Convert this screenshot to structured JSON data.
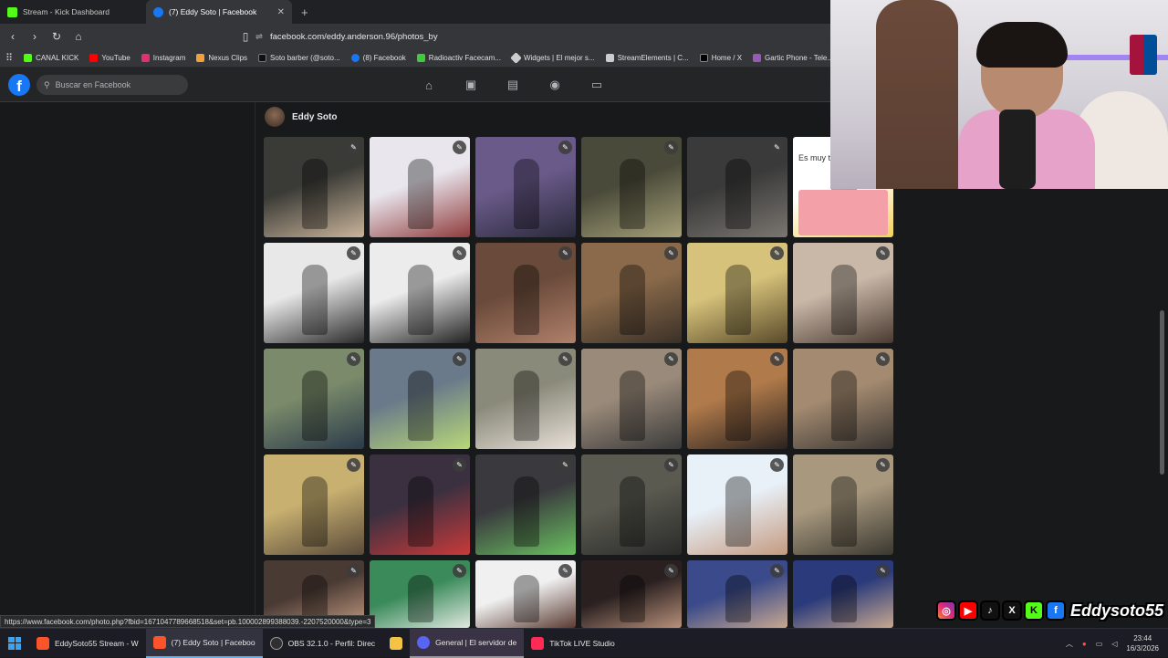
{
  "browser": {
    "tabs": [
      {
        "title": "Stream - Kick Dashboard",
        "color": "#53fc18",
        "active": false
      },
      {
        "title": "(7) Eddy Soto | Facebook",
        "color": "#1877f2",
        "active": true
      }
    ],
    "url": "facebook.com/eddy.anderson.96/photos_by",
    "bookmarks": [
      {
        "label": "CANAL KICK",
        "color": "#53fc18"
      },
      {
        "label": "YouTube",
        "color": "#ff0000"
      },
      {
        "label": "Instagram",
        "color": "#e1306c"
      },
      {
        "label": "Nexus Clips",
        "color": "#f2a13a"
      },
      {
        "label": "Soto barber (@soto...",
        "color": "#111111"
      },
      {
        "label": "(8) Facebook",
        "color": "#1877f2"
      },
      {
        "label": "Radioactiv Facecam...",
        "color": "#3ccc3c"
      },
      {
        "label": "Widgets | El mejor s...",
        "color": "#cccccc"
      },
      {
        "label": "StreamElements | C...",
        "color": "#cccccc"
      },
      {
        "label": "Home / X",
        "color": "#000000"
      },
      {
        "label": "Gartic Phone - Tele...",
        "color": "#9b59b6"
      }
    ]
  },
  "facebook": {
    "search_placeholder": "Buscar en Facebook",
    "nav_icons": [
      "home-icon",
      "video-icon",
      "marketplace-icon",
      "groups-icon",
      "gaming-icon"
    ],
    "profile_name": "Eddy Soto",
    "partial_text": "Es muy ti",
    "photo_rows": 5,
    "photo_cols": 6
  },
  "status_url": "https://www.facebook.com/photo.php?fbid=1671047789668518&set=pb.100002899388039.-2207520000&type=3",
  "overlay": {
    "social_name": "Eddysoto55",
    "social_icons": [
      "instagram-icon",
      "youtube-icon",
      "tiktok-icon",
      "x-icon",
      "kick-icon",
      "facebook-icon"
    ]
  },
  "taskbar": {
    "items": [
      {
        "label": "EddySoto55 Stream - W",
        "color": "#fb542b",
        "active": false
      },
      {
        "label": "(7) Eddy Soto | Faceboo",
        "color": "#fb542b",
        "active": true
      },
      {
        "label": "OBS 32.1.0 - Perfil: Direc",
        "color": "#302e31",
        "active": false
      },
      {
        "label": "",
        "color": "#f3c444",
        "active": false
      },
      {
        "label": "General | El servidor de",
        "color": "#5865f2",
        "active": false
      },
      {
        "label": "TikTok LIVE Studio",
        "color": "#fe2c55",
        "active": false
      }
    ],
    "time": "23:44",
    "date": "16/3/2026"
  }
}
